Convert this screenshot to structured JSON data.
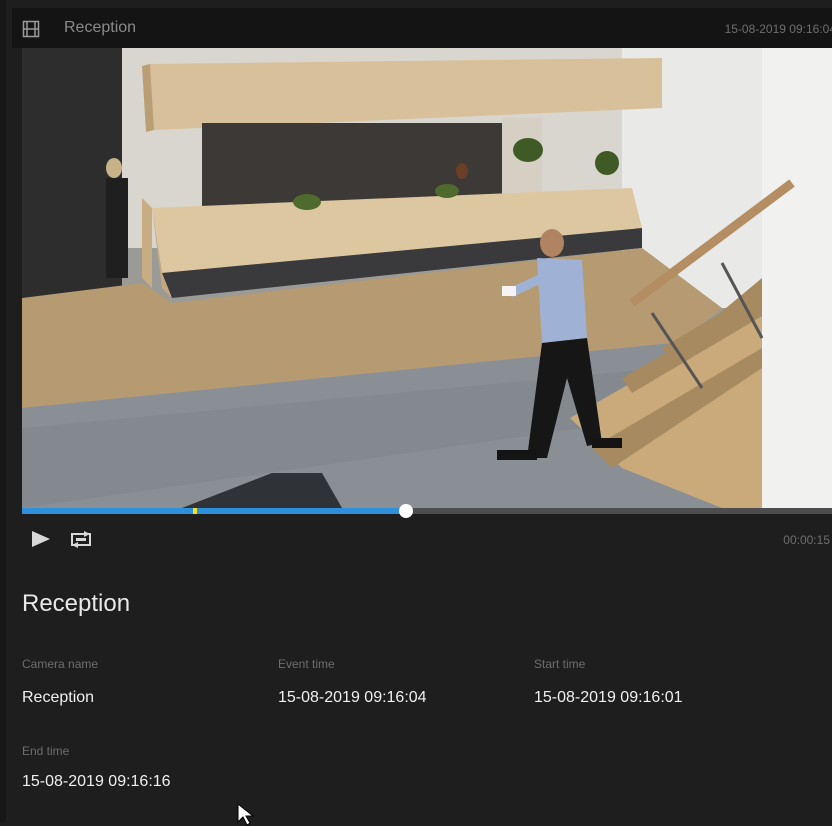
{
  "window": {
    "title": "Reception",
    "timestamp": "15-08-2019 09:16:04",
    "icon": "film-icon"
  },
  "player": {
    "progress": 0.47,
    "event_marker": 0.21,
    "duration_label": "00:00:15",
    "accent_color": "#2e8fdb",
    "marker_color": "#f2e21a",
    "play_icon": "play-icon",
    "loop_icon": "loop-icon"
  },
  "details": {
    "heading": "Reception",
    "fields": [
      {
        "label": "Camera name",
        "value": "Reception"
      },
      {
        "label": "Event time",
        "value": "15-08-2019 09:16:04"
      },
      {
        "label": "Start time",
        "value": "15-08-2019 09:16:01"
      },
      {
        "label": "End time",
        "value": "15-08-2019 09:16:16"
      }
    ]
  }
}
